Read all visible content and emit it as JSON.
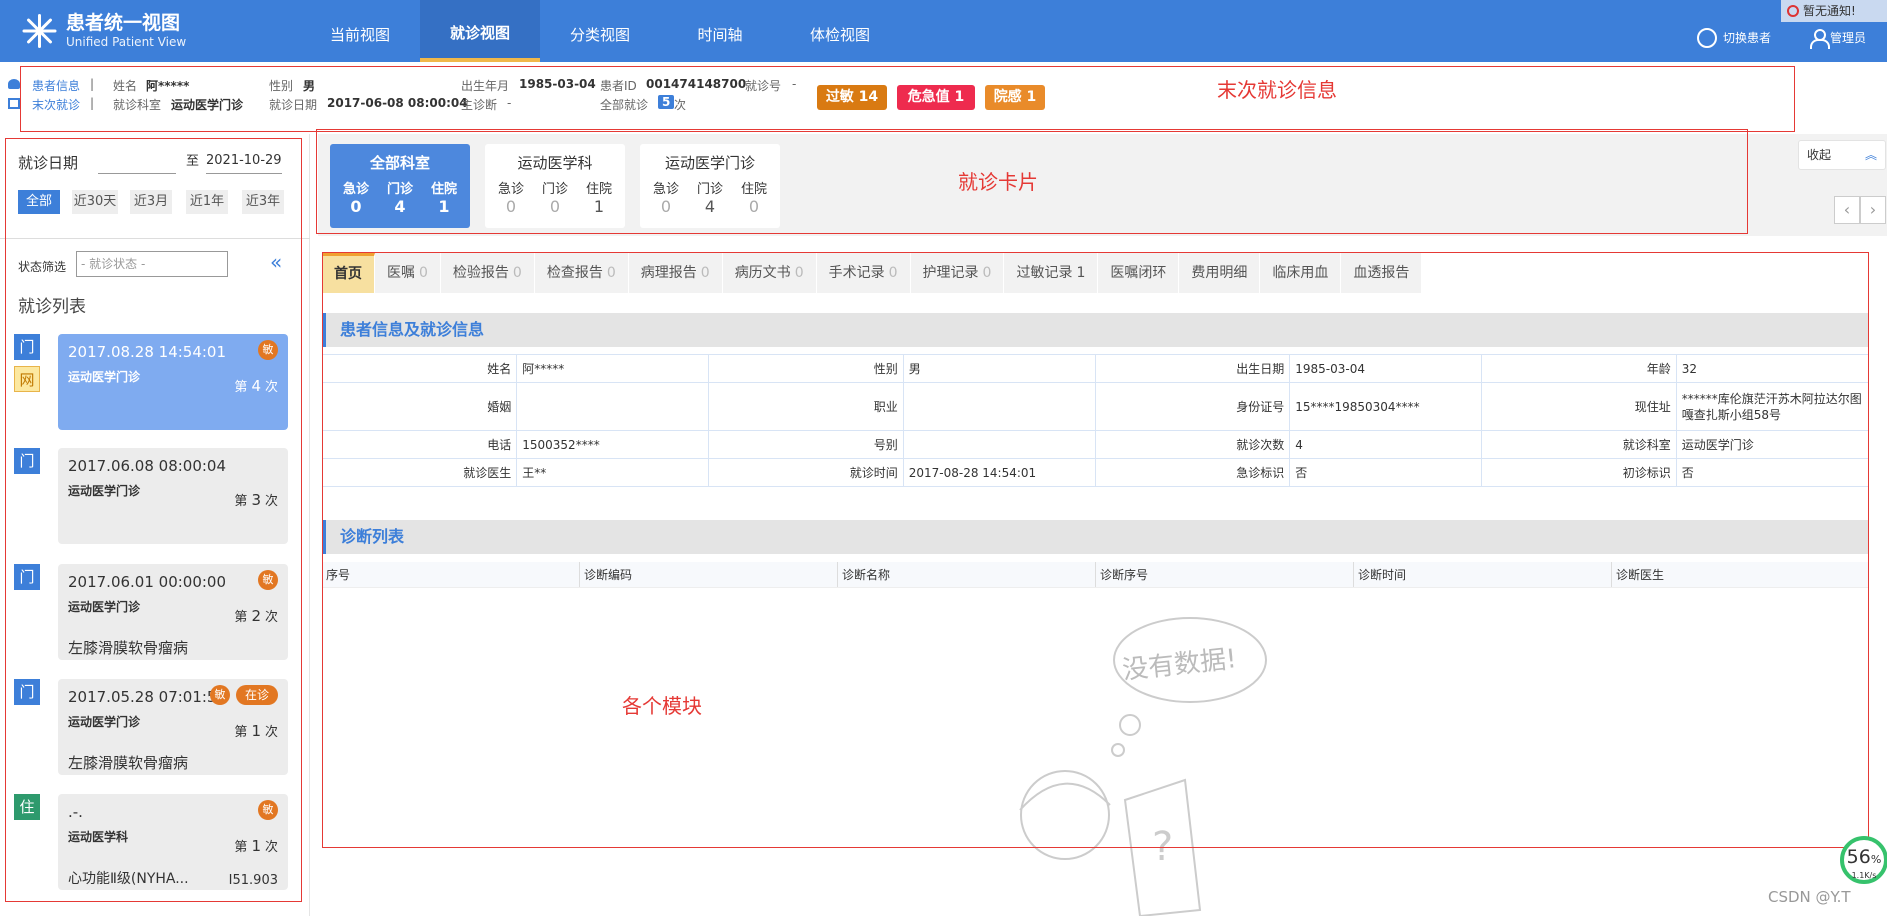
{
  "app": {
    "title": "患者统一视图",
    "subtitle": "Unified Patient View"
  },
  "nav": [
    {
      "label": "当前视图"
    },
    {
      "label": "就诊视图",
      "active": true
    },
    {
      "label": "分类视图"
    },
    {
      "label": "时间轴"
    },
    {
      "label": "体检视图"
    }
  ],
  "header": {
    "notice": "暂无通知!",
    "switch_patient": "切换患者",
    "admin": "管理员"
  },
  "patient_bar": {
    "patient_info_label": "患者信息",
    "last_visit_label": "末次就诊",
    "separator": "|",
    "name_label": "姓名",
    "name": "阿*****",
    "gender_label": "性别",
    "gender": "男",
    "birth_label": "出生年月",
    "birth": "1985-03-04",
    "pid_label": "患者ID",
    "pid": "001474148700",
    "visit_no_label": "就诊号",
    "visit_no": "-",
    "dept_label": "就诊科室",
    "dept": "运动医学门诊",
    "date_label": "就诊日期",
    "date": "2017-06-08 08:00:04",
    "diag_label": "主诊断",
    "diag": "-",
    "all_visits_label": "全部就诊",
    "all_visits_count": "5",
    "all_visits_unit": "次",
    "badges": [
      {
        "label": "过敏 14",
        "color": "#d97a12"
      },
      {
        "label": "危急值 1",
        "color": "#ee2b4e"
      },
      {
        "label": "院感 1",
        "color": "#e98b2a"
      }
    ]
  },
  "annotations": {
    "last_visit": "末次就诊信息",
    "visit_cards": "就诊卡片",
    "modules": "各个模块"
  },
  "sidebar": {
    "date_label": "就诊日期",
    "date_from": "",
    "date_to_label": "至",
    "date_to": "2021-10-29",
    "ranges": [
      {
        "label": "全部",
        "active": true
      },
      {
        "label": "近30天"
      },
      {
        "label": "近3月"
      },
      {
        "label": "近1年"
      },
      {
        "label": "近3年"
      }
    ],
    "filter_label": "状态筛选",
    "filter_placeholder": "- 就诊状态 -",
    "list_title": "就诊列表",
    "visits": [
      {
        "types": [
          "门",
          "网"
        ],
        "date": "2017.08.28 14:54:01",
        "dept": "运动医学门诊",
        "count_prefix": "第",
        "count": "4",
        "count_suffix": "次",
        "diag": "",
        "code": "",
        "tag_min": "敏",
        "tag_status": ""
      },
      {
        "types": [
          "门"
        ],
        "date": "2017.06.08 08:00:04",
        "dept": "运动医学门诊",
        "count_prefix": "第",
        "count": "3",
        "count_suffix": "次",
        "diag": "",
        "code": "",
        "tag_min": "",
        "tag_status": ""
      },
      {
        "types": [
          "门"
        ],
        "date": "2017.06.01 00:00:00",
        "dept": "运动医学门诊",
        "count_prefix": "第",
        "count": "2",
        "count_suffix": "次",
        "diag": "左膝滑膜软骨瘤病",
        "code": "",
        "tag_min": "敏",
        "tag_status": ""
      },
      {
        "types": [
          "门"
        ],
        "date": "2017.05.28 07:01:56",
        "dept": "运动医学门诊",
        "count_prefix": "第",
        "count": "1",
        "count_suffix": "次",
        "diag": "左膝滑膜软骨瘤病",
        "code": "",
        "tag_min": "敏",
        "tag_status": "在诊"
      },
      {
        "types": [
          "住"
        ],
        "date": ".-.",
        "dept": "运动医学科",
        "count_prefix": "第",
        "count": "1",
        "count_suffix": "次",
        "diag": "心功能Ⅱ级(NYHA...",
        "code": "I51.903",
        "tag_min": "敏",
        "tag_status": ""
      }
    ]
  },
  "dept_cards": {
    "collapse_label": "收起",
    "cards": [
      {
        "name": "全部科室",
        "labels": [
          "急诊",
          "门诊",
          "住院"
        ],
        "values": [
          "0",
          "4",
          "1"
        ],
        "active": true
      },
      {
        "name": "运动医学科",
        "labels": [
          "急诊",
          "门诊",
          "住院"
        ],
        "values": [
          "0",
          "0",
          "1"
        ]
      },
      {
        "name": "运动医学门诊",
        "labels": [
          "急诊",
          "门诊",
          "住院"
        ],
        "values": [
          "0",
          "4",
          "0"
        ]
      }
    ]
  },
  "tabs": [
    {
      "label": "首页",
      "count": "",
      "active": true
    },
    {
      "label": "医嘱",
      "count": "0"
    },
    {
      "label": "检验报告",
      "count": "0"
    },
    {
      "label": "检查报告",
      "count": "0"
    },
    {
      "label": "病理报告",
      "count": "0"
    },
    {
      "label": "病历文书",
      "count": "0"
    },
    {
      "label": "手术记录",
      "count": "0"
    },
    {
      "label": "护理记录",
      "count": "0"
    },
    {
      "label": "过敏记录",
      "count": "1"
    },
    {
      "label": "医嘱闭环",
      "count": ""
    },
    {
      "label": "费用明细",
      "count": ""
    },
    {
      "label": "临床用血",
      "count": ""
    },
    {
      "label": "血透报告",
      "count": ""
    }
  ],
  "patient_section": {
    "title": "患者信息及就诊信息",
    "rows": [
      [
        [
          "姓名",
          "阿*****"
        ],
        [
          "性别",
          "男"
        ],
        [
          "出生日期",
          "1985-03-04"
        ],
        [
          "年龄",
          "32"
        ]
      ],
      [
        [
          "婚姻",
          ""
        ],
        [
          "职业",
          ""
        ],
        [
          "身份证号",
          "15****19850304****"
        ],
        [
          "现住址",
          "******库伦旗茫汗苏木阿拉达尔图嘎查扎斯小组58号"
        ]
      ],
      [
        [
          "电话",
          "1500352****"
        ],
        [
          "号别",
          ""
        ],
        [
          "就诊次数",
          "4"
        ],
        [
          "就诊科室",
          "运动医学门诊"
        ]
      ],
      [
        [
          "就诊医生",
          "王**"
        ],
        [
          "就诊时间",
          "2017-08-28 14:54:01"
        ],
        [
          "急诊标识",
          "否"
        ],
        [
          "初诊标识",
          "否"
        ]
      ]
    ]
  },
  "diagnosis_section": {
    "title": "诊断列表",
    "columns": [
      "序号",
      "诊断编码",
      "诊断名称",
      "诊断序号",
      "诊断时间",
      "诊断医生"
    ],
    "empty_text": "没有数据!"
  },
  "status": {
    "progress_percent": 56,
    "progress_text": "56",
    "progress_unit": "%",
    "speed": "1.1K/s"
  },
  "watermark": "CSDN @Y.T"
}
